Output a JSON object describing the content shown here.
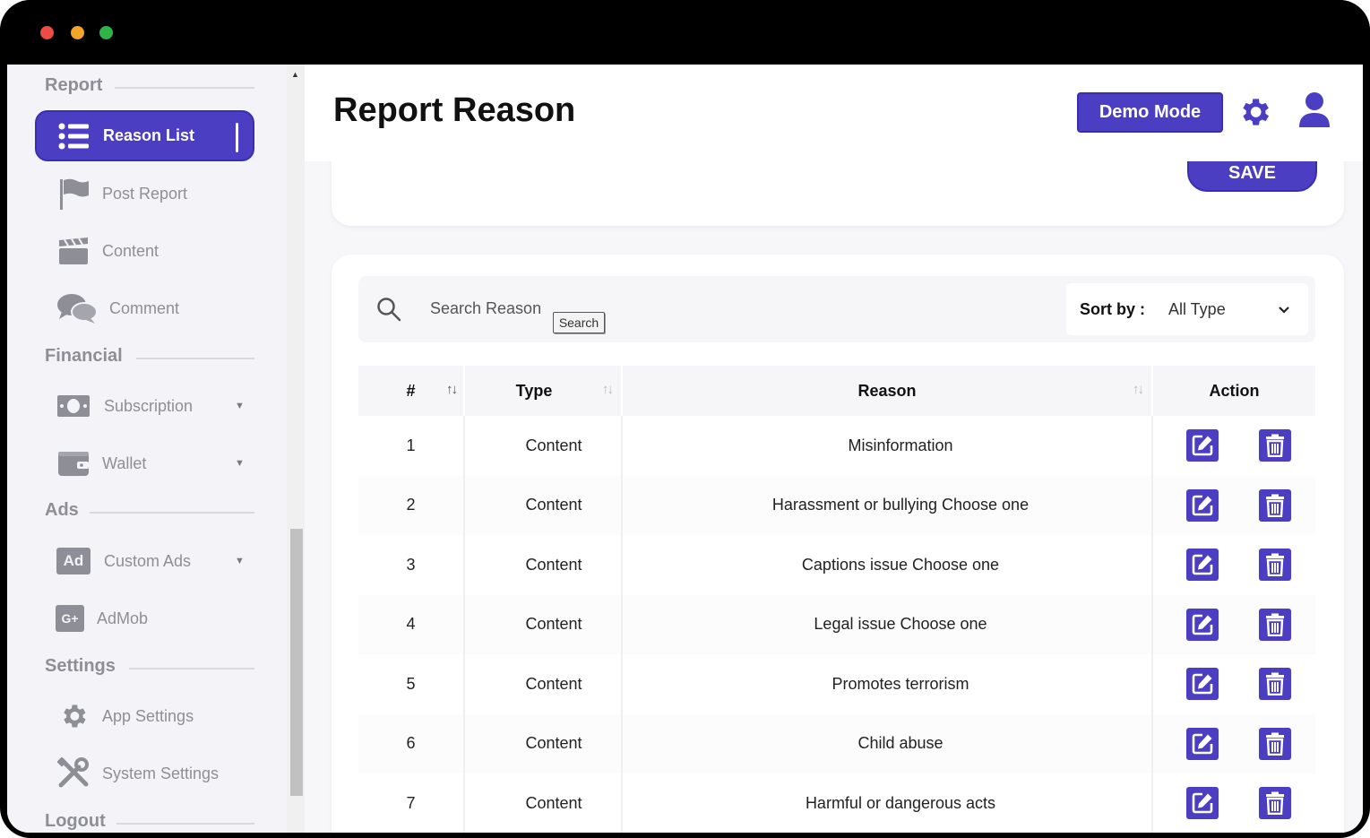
{
  "window": {
    "title": ""
  },
  "sidebar": {
    "sections": {
      "report": "Report",
      "financial": "Financial",
      "ads": "Ads",
      "settings": "Settings",
      "logout": "Logout"
    },
    "items": {
      "reason_list": "Reason List",
      "post_report": "Post Report",
      "content": "Content",
      "comment": "Comment",
      "subscription": "Subscription",
      "wallet": "Wallet",
      "custom_ads": "Custom Ads",
      "admob": "AdMob",
      "app_settings": "App Settings",
      "system_settings": "System Settings"
    },
    "icons": {
      "ad_badge": "Ad",
      "admob_badge": "G+"
    }
  },
  "header": {
    "title": "Report Reason",
    "demo_mode": "Demo Mode"
  },
  "form": {
    "save_label": "SAVE"
  },
  "search": {
    "placeholder": "Search Reason",
    "button": "Search",
    "sort_label": "Sort by :",
    "sort_value": "All Type"
  },
  "table": {
    "columns": [
      "#",
      "Type",
      "Reason",
      "Action"
    ],
    "rows": [
      {
        "num": "1",
        "type": "Content",
        "reason": "Misinformation"
      },
      {
        "num": "2",
        "type": "Content",
        "reason": "Harassment or bullying Choose one"
      },
      {
        "num": "3",
        "type": "Content",
        "reason": "Captions issue Choose one"
      },
      {
        "num": "4",
        "type": "Content",
        "reason": "Legal issue Choose one"
      },
      {
        "num": "5",
        "type": "Content",
        "reason": "Promotes terrorism"
      },
      {
        "num": "6",
        "type": "Content",
        "reason": "Child abuse"
      },
      {
        "num": "7",
        "type": "Content",
        "reason": "Harmful or dangerous acts"
      }
    ]
  },
  "colors": {
    "accent": "#4b3ec2",
    "sidebar_bg": "#f4f4f8",
    "muted_text": "#8e8e96"
  }
}
